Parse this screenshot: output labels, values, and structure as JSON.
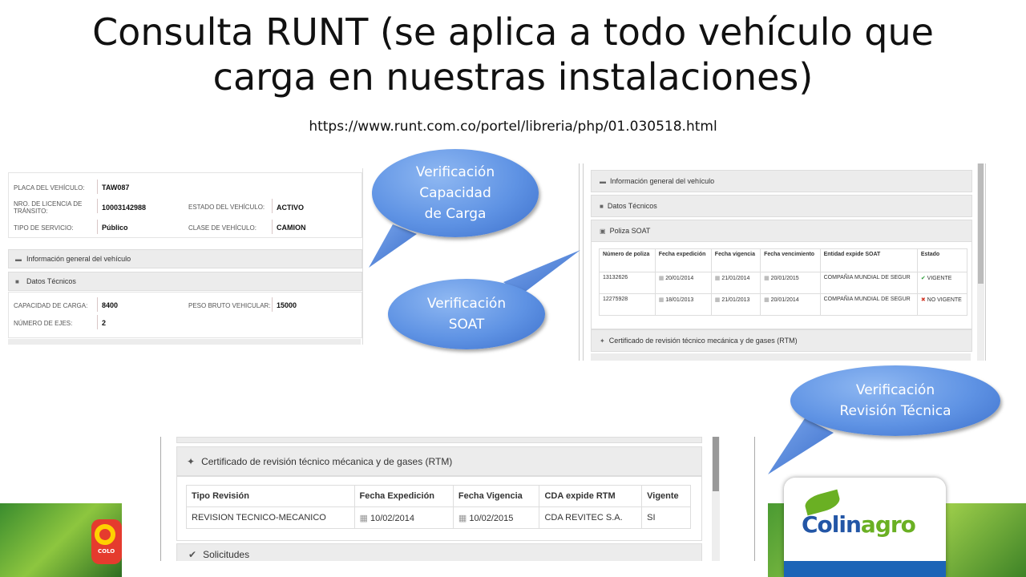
{
  "slide": {
    "title": "Consulta RUNT (se aplica a todo vehículo que carga en nuestras instalaciones)",
    "url": "https://www.runt.com.co/portel/libreria/php/01.030518.html"
  },
  "vehicle_panel": {
    "placa_label": "PLACA DEL VEHÍCULO:",
    "placa_value": "TAW087",
    "licencia_label": "NRO. DE LICENCIA DE TRÁNSITO:",
    "licencia_value": "10003142988",
    "estado_label": "ESTADO DEL VEHÍCULO:",
    "estado_value": "ACTIVO",
    "servicio_label": "TIPO DE SERVICIO:",
    "servicio_value": "Público",
    "clase_label": "CLASE DE VEHÍCULO:",
    "clase_value": "CAMION",
    "info_general": "Información general del vehículo",
    "datos_tecnicos": "Datos Técnicos",
    "capacidad_label": "CAPACIDAD DE CARGA:",
    "capacidad_value": "8400",
    "peso_label": "PESO BRUTO VEHICULAR:",
    "peso_value": "15000",
    "ejes_label": "NÚMERO DE EJES:",
    "ejes_value": "2"
  },
  "soat_panel": {
    "info_general": "Información general del vehículo",
    "datos_tecnicos": "Datos Técnicos",
    "poliza": "Poliza SOAT",
    "headers": [
      "Número de poliza",
      "Fecha expedición",
      "Fecha vigencia",
      "Fecha vencimiento",
      "Entidad expide SOAT",
      "Estado"
    ],
    "rows": [
      {
        "numero": "13132626",
        "expedicion": "20/01/2014",
        "vigencia": "21/01/2014",
        "vencimiento": "20/01/2015",
        "entidad": "COMPAÑIA MUNDIAL DE SEGUR",
        "estado": "VIGENTE"
      },
      {
        "numero": "12275928",
        "expedicion": "18/01/2013",
        "vigencia": "21/01/2013",
        "vencimiento": "20/01/2014",
        "entidad": "COMPAÑIA MUNDIAL DE SEGUR",
        "estado": "NO VIGENTE"
      }
    ],
    "certificado": "Certificado de revisión técnico mecánica y de gases (RTM)"
  },
  "rtm_panel": {
    "certificado": "Certificado de revisión técnico mécanica y de gases (RTM)",
    "headers": [
      "Tipo Revisión",
      "Fecha Expedición",
      "Fecha Vigencia",
      "CDA expide RTM",
      "Vigente"
    ],
    "row": {
      "tipo": "REVISION TECNICO-MECANICO",
      "expedicion": "10/02/2014",
      "vigencia": "10/02/2015",
      "cda": "CDA REVITEC S.A.",
      "vigente": "SI"
    },
    "solicitudes": "Solicitudes"
  },
  "callouts": {
    "carga": [
      "Verificación",
      "Capacidad",
      "de Carga"
    ],
    "soat": [
      "Verificación",
      "SOAT"
    ],
    "tecnica": [
      "Verificación",
      "Revisión Técnica"
    ]
  },
  "logo": {
    "brand_a": "Colin",
    "brand_b": "agro",
    "small": "COLO"
  },
  "colors": {
    "callout": "#5f93e4",
    "brand_blue": "#2356a6",
    "brand_green": "#6ab023",
    "vigente_green": "#2e9d3b",
    "no_vigente_red": "#d23a2a"
  }
}
